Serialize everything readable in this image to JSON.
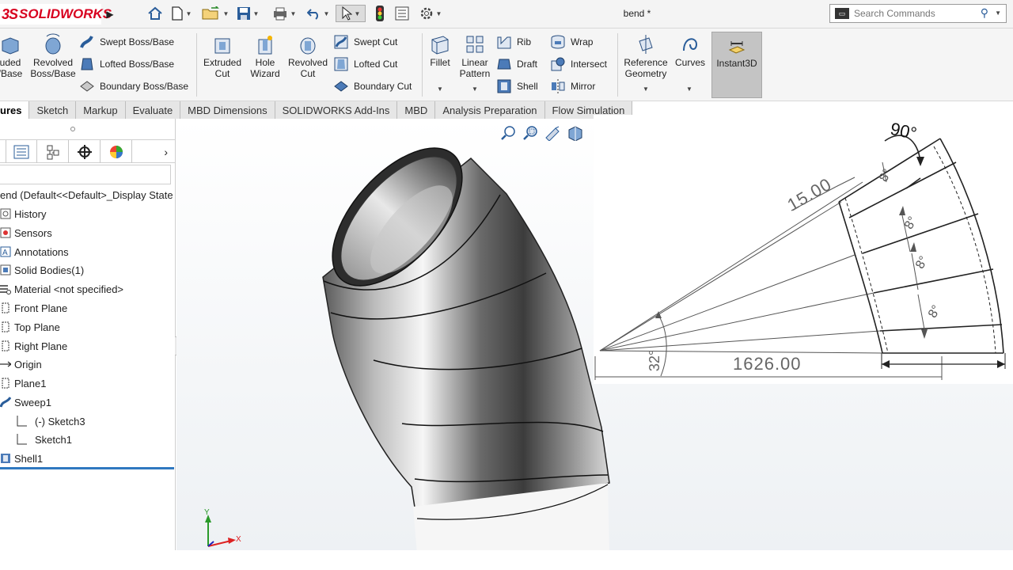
{
  "app": {
    "logo_prefix": "3S",
    "logo_text": "SOLIDWORKS",
    "document_title": "bend *"
  },
  "quick_access": {
    "icons": [
      "home-icon",
      "new-document-icon",
      "open-icon",
      "save-icon",
      "print-icon",
      "undo-icon",
      "select-icon",
      "rebuild-icon",
      "file-properties-icon",
      "options-icon"
    ]
  },
  "search": {
    "placeholder": "Search Commands"
  },
  "ribbon": {
    "extruded_boss": "uded\n/Base",
    "revolved_boss": "Revolved\nBoss/Base",
    "swept_boss": "Swept Boss/Base",
    "lofted_boss": "Lofted Boss/Base",
    "boundary_boss": "Boundary Boss/Base",
    "extruded_cut": "Extruded\nCut",
    "hole_wizard": "Hole\nWizard",
    "revolved_cut": "Revolved\nCut",
    "swept_cut": "Swept Cut",
    "lofted_cut": "Lofted Cut",
    "boundary_cut": "Boundary Cut",
    "fillet": "Fillet",
    "linear_pattern": "Linear\nPattern",
    "rib": "Rib",
    "draft": "Draft",
    "shell": "Shell",
    "wrap": "Wrap",
    "intersect": "Intersect",
    "mirror": "Mirror",
    "reference_geometry": "Reference\nGeometry",
    "curves": "Curves",
    "instant3d": "Instant3D"
  },
  "tabs": [
    "ures",
    "Sketch",
    "Markup",
    "Evaluate",
    "MBD Dimensions",
    "SOLIDWORKS Add-Ins",
    "MBD",
    "Analysis Preparation",
    "Flow Simulation"
  ],
  "active_tab": "ures",
  "feature_tree": {
    "root": "end  (Default<<Default>_Display State",
    "items": [
      "History",
      "Sensors",
      "Annotations",
      "Solid Bodies(1)",
      "Material <not specified>",
      "Front Plane",
      "Top Plane",
      "Right Plane",
      "Origin",
      "Plane1",
      "Sweep1",
      "(-) Sketch3",
      "Sketch1",
      "Shell1"
    ]
  },
  "drawing": {
    "angle_top": "90°",
    "wall": "15.00",
    "seg_angle": "8°",
    "bend_angle": "32°",
    "radius": "1626.00"
  },
  "triad": {
    "y": "Y",
    "x": "X"
  }
}
